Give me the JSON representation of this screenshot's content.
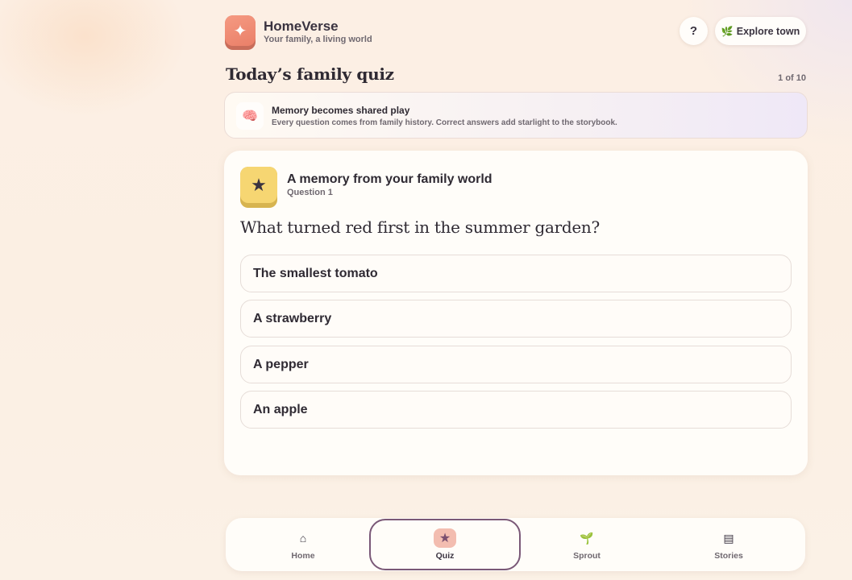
{
  "header": {
    "brand_name": "HomeVerse",
    "brand_tagline": "Your family, a living world",
    "logo_icon": "sparkle-icon",
    "help_label": "?",
    "explore_label": "Explore town",
    "explore_icon": "leaf-icon"
  },
  "page": {
    "title": "Today’s family quiz",
    "progress": "1 of 10"
  },
  "banner": {
    "icon": "brain-icon",
    "title": "Memory becomes shared play",
    "subtitle": "Every question comes from family history. Correct answers add starlight to the storybook."
  },
  "quiz": {
    "badge_icon": "star-icon",
    "card_title": "A memory from your family world",
    "question_number": "Question 1",
    "question": "What turned red first in the summer garden?",
    "answers": [
      "The smallest tomato",
      "A strawberry",
      "A pepper",
      "An apple"
    ]
  },
  "nav": {
    "items": [
      {
        "label": "Home",
        "icon": "home-icon",
        "active": false
      },
      {
        "label": "Quiz",
        "icon": "star-icon",
        "active": true
      },
      {
        "label": "Sprout",
        "icon": "sprout-icon",
        "active": false
      },
      {
        "label": "Stories",
        "icon": "book-icon",
        "active": false
      }
    ]
  },
  "colors": {
    "accent": "#ea7f68",
    "active_outline": "#7a5877",
    "badge_yellow": "#f6d672"
  }
}
